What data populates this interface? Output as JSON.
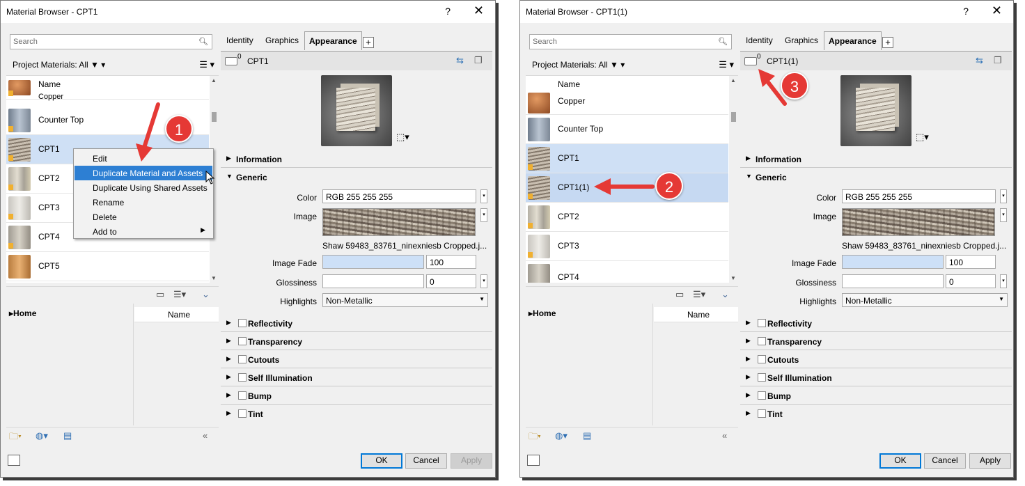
{
  "left_dialog": {
    "title": "Material Browser - CPT1",
    "help": "?",
    "close": "✕",
    "search_placeholder": "Search",
    "project_label": "Project Materials: All",
    "list_header": "Name",
    "materials": [
      "Copper",
      "Counter Top",
      "CPT1",
      "CPT2",
      "CPT3",
      "CPT4",
      "CPT5"
    ],
    "context_menu": [
      "Edit",
      "Duplicate Material and Assets",
      "Duplicate Using Shared Assets",
      "Rename",
      "Delete",
      "Add to"
    ],
    "library_home": "Home",
    "library_header": "Name",
    "tabs": [
      "Identity",
      "Graphics",
      "Appearance"
    ],
    "asset_count": "0",
    "asset_name": "CPT1",
    "sections": {
      "information": "Information",
      "generic": "Generic",
      "reflectivity": "Reflectivity",
      "transparency": "Transparency",
      "cutouts": "Cutouts",
      "self_illumination": "Self Illumination",
      "bump": "Bump",
      "tint": "Tint"
    },
    "props": {
      "color_label": "Color",
      "color_value": "RGB 255 255 255",
      "image_label": "Image",
      "image_name": "Shaw 59483_83761_ninexniesb Cropped.j...",
      "fade_label": "Image Fade",
      "fade_value": "100",
      "gloss_label": "Glossiness",
      "gloss_value": "0",
      "highlights_label": "Highlights",
      "highlights_value": "Non-Metallic"
    },
    "buttons": {
      "ok": "OK",
      "cancel": "Cancel",
      "apply": "Apply"
    },
    "callout": "1"
  },
  "right_dialog": {
    "title": "Material Browser - CPT1(1)",
    "help": "?",
    "close": "✕",
    "search_placeholder": "Search",
    "project_label": "Project Materials: All",
    "list_header": "Name",
    "materials": [
      "Copper",
      "Counter Top",
      "CPT1",
      "CPT1(1)",
      "CPT2",
      "CPT3",
      "CPT4"
    ],
    "library_home": "Home",
    "library_header": "Name",
    "tabs": [
      "Identity",
      "Graphics",
      "Appearance"
    ],
    "asset_count": "0",
    "asset_name": "CPT1(1)",
    "sections": {
      "information": "Information",
      "generic": "Generic",
      "reflectivity": "Reflectivity",
      "transparency": "Transparency",
      "cutouts": "Cutouts",
      "self_illumination": "Self Illumination",
      "bump": "Bump",
      "tint": "Tint"
    },
    "props": {
      "color_label": "Color",
      "color_value": "RGB 255 255 255",
      "image_label": "Image",
      "image_name": "Shaw 59483_83761_ninexniesb Cropped.j...",
      "fade_label": "Image Fade",
      "fade_value": "100",
      "gloss_label": "Glossiness",
      "gloss_value": "0",
      "highlights_label": "Highlights",
      "highlights_value": "Non-Metallic"
    },
    "buttons": {
      "ok": "OK",
      "cancel": "Cancel",
      "apply": "Apply"
    },
    "callout2": "2",
    "callout3": "3"
  },
  "colors": {
    "callout": "#e53935",
    "selection": "#cfe0f5",
    "menu_highlight": "#2d7fd3",
    "ok_border": "#0078d7"
  }
}
